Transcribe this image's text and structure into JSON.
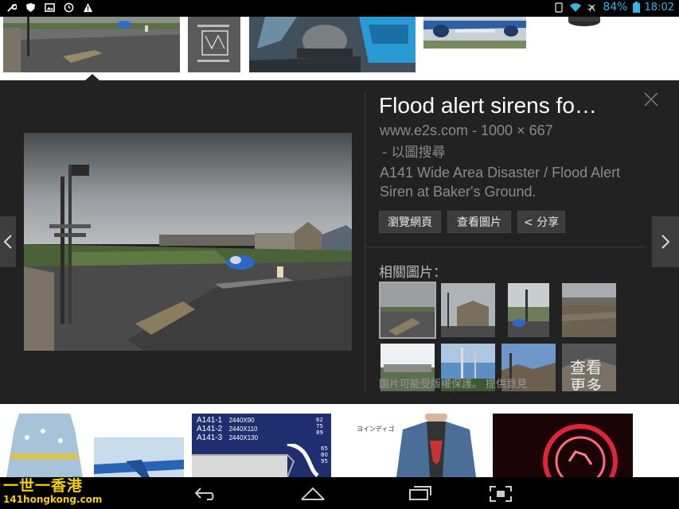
{
  "status_bar": {
    "battery_percent": "84%",
    "time": "18:02",
    "left_icons": [
      "wrench-icon",
      "shield-icon",
      "image-icon",
      "clock-icon",
      "warning-icon"
    ],
    "right_icons": [
      "rotate-icon",
      "wifi-icon",
      "airplane-icon",
      "battery-icon"
    ]
  },
  "detail": {
    "title": "Flood alert sirens fo…",
    "source": "www.e2s.com - 1000 × 667",
    "search_by_image": " - 以圖搜尋",
    "description": "A141 Wide Area Disaster / Flood Alert Siren at Baker's Ground.",
    "buttons": {
      "visit_page": "瀏覽網頁",
      "view_image": "查看圖片",
      "share": "< 分享"
    },
    "related_label": "相關圖片：",
    "copyright_note": "圖片可能受版權保護。   提供意見",
    "more_label": "查看\n更多"
  },
  "bottom_strip": {
    "product_box": {
      "rows": [
        {
          "code": "A141-1",
          "size": "2440X90"
        },
        {
          "code": "A141-2",
          "size": "2440X110"
        },
        {
          "code": "A141-3",
          "size": "2440X130"
        }
      ],
      "dims_top": [
        "62",
        "75",
        "89"
      ],
      "dims_bottom": [
        "65",
        "80",
        "95"
      ]
    },
    "jacket_caption": "ヨインディゴ"
  },
  "watermark": {
    "line1": "一世一香港",
    "line2": "141hongkong.com"
  },
  "colors": {
    "accent": "#33b5e5",
    "panel_bg": "#222222",
    "watermark": "#f5d000"
  }
}
